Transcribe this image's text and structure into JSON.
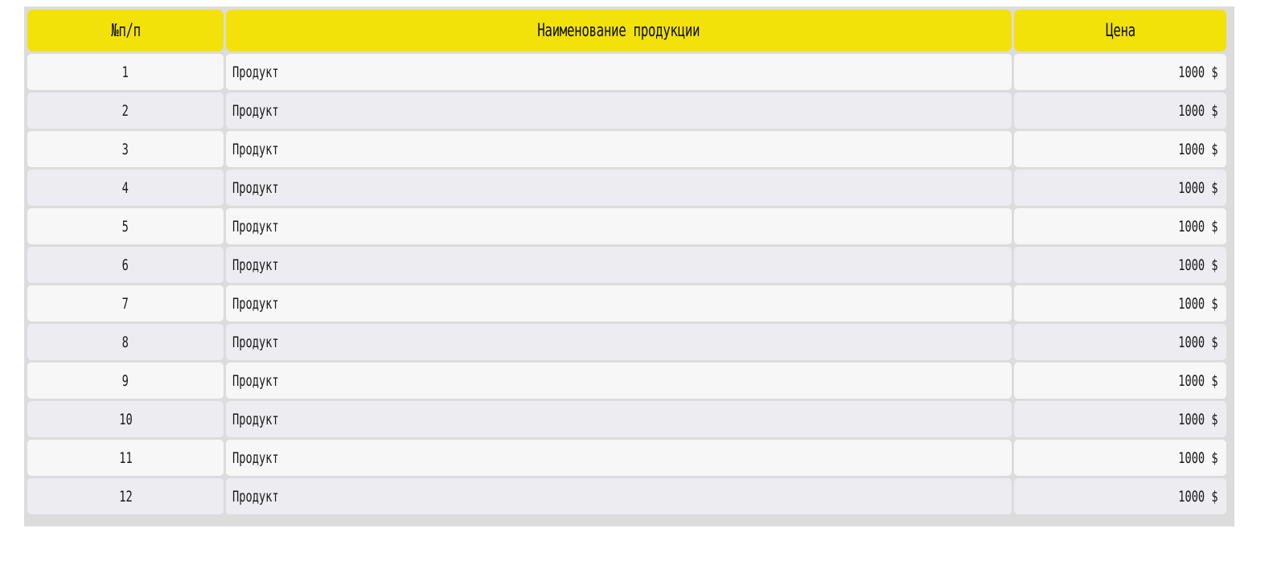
{
  "table": {
    "headers": {
      "number": "№п/п",
      "name": "Наименование продукции",
      "price": "Цена"
    },
    "rows": [
      {
        "number": "1",
        "name": "Продукт",
        "price": "1000 $"
      },
      {
        "number": "2",
        "name": "Продукт",
        "price": "1000 $"
      },
      {
        "number": "3",
        "name": "Продукт",
        "price": "1000 $"
      },
      {
        "number": "4",
        "name": "Продукт",
        "price": "1000 $"
      },
      {
        "number": "5",
        "name": "Продукт",
        "price": "1000 $"
      },
      {
        "number": "6",
        "name": "Продукт",
        "price": "1000 $"
      },
      {
        "number": "7",
        "name": "Продукт",
        "price": "1000 $"
      },
      {
        "number": "8",
        "name": "Продукт",
        "price": "1000 $"
      },
      {
        "number": "9",
        "name": "Продукт",
        "price": "1000 $"
      },
      {
        "number": "10",
        "name": "Продукт",
        "price": "1000 $"
      },
      {
        "number": "11",
        "name": "Продукт",
        "price": "1000 $"
      },
      {
        "number": "12",
        "name": "Продукт",
        "price": "1000 $"
      }
    ]
  },
  "colors": {
    "header_bg": "#f2e20a",
    "row_odd_bg": "#f7f7f8",
    "row_even_bg": "#ececf1",
    "frame_border": "#dcdcdc"
  }
}
